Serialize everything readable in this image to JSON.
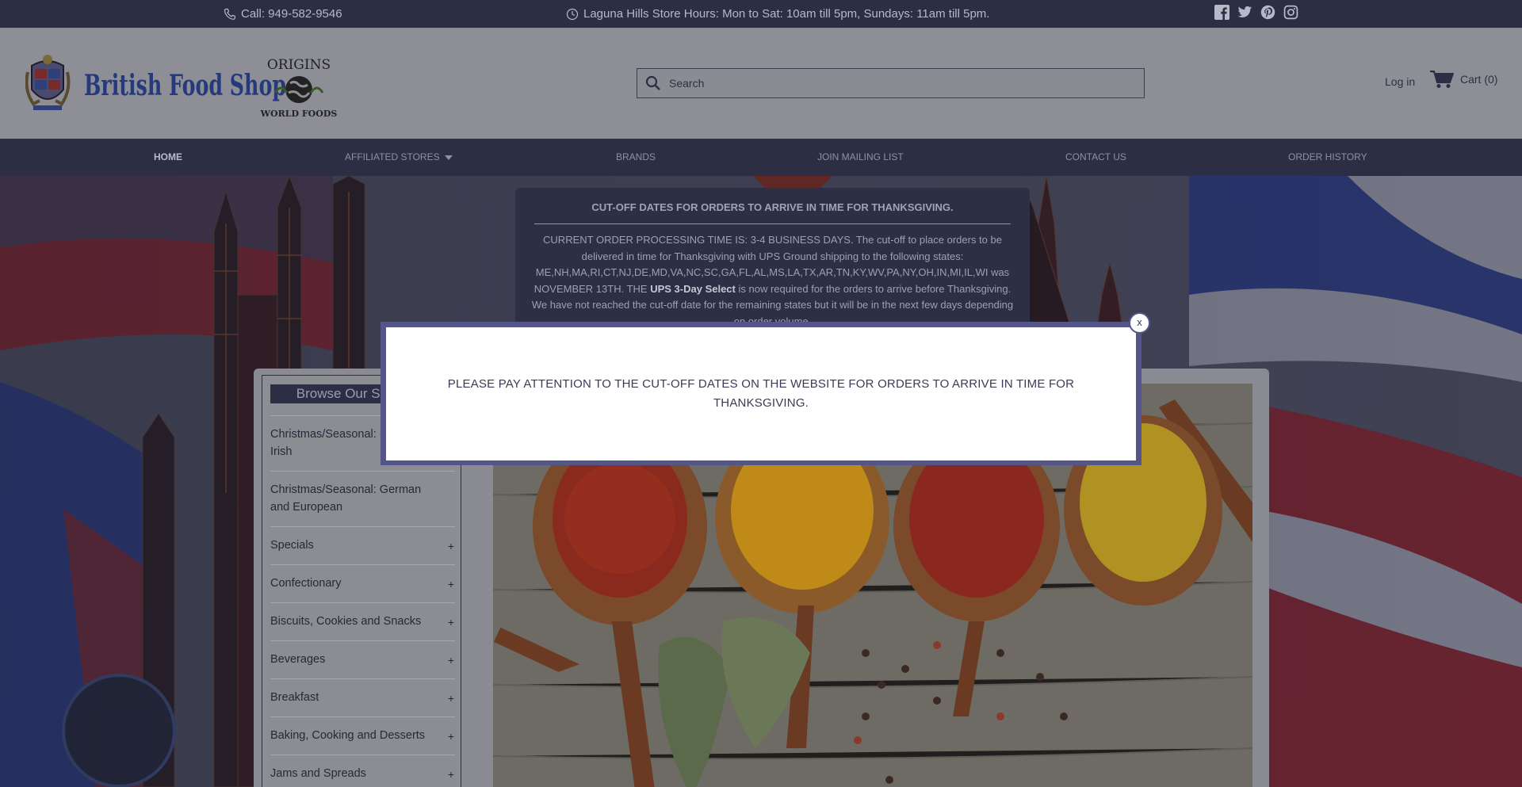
{
  "topbar": {
    "phone": "Call: 949-582-9546",
    "hours": "Laguna Hills Store Hours: Mon to Sat: 10am till 5pm, Sundays: 11am till 5pm.",
    "social_icons": [
      "facebook-icon",
      "twitter-icon",
      "pinterest-icon",
      "instagram-icon"
    ]
  },
  "header": {
    "logo": {
      "text": "British Food Shop",
      "partner_top": "ORIGINS",
      "partner_bottom": "WORLD FOODS"
    },
    "search_placeholder": "Search",
    "login": "Log in",
    "cart": "Cart (0)"
  },
  "nav": [
    {
      "label": "HOME"
    },
    {
      "label": "AFFILIATED STORES"
    },
    {
      "label": "BRANDS"
    },
    {
      "label": "JOIN MAILING LIST"
    },
    {
      "label": "CONTACT US"
    },
    {
      "label": "ORDER HISTORY"
    }
  ],
  "notice": {
    "title": "CUT-OFF DATES FOR ORDERS TO ARRIVE IN TIME FOR THANKSGIVING.",
    "body_1": "CURRENT ORDER PROCESSING TIME IS: 3-4 BUSINESS DAYS. The cut-off to place orders to be delivered in time for Thanksgiving with UPS Ground shipping to the following states: ME,NH,MA,RI,CT,NJ,DE,MD,VA,NC,SC,GA,FL,AL,MS,LA,TX,AR,TN,KY,WV,PA,NY,OH,IN,MI,IL,WI was NOVEMBER 13TH. THE ",
    "body_bold": "UPS 3-Day Select",
    "body_2": " is now required for the orders to arrive before Thanksgiving. We have not reached the cut-off date for the remaining states but it will be in the next few days depending on order volume."
  },
  "sidebar": {
    "title": "Browse Our Selection",
    "items": [
      {
        "label": "Christmas/Seasonal: British and Irish",
        "plus": ""
      },
      {
        "label": "Christmas/Seasonal: German and European",
        "plus": ""
      },
      {
        "label": "Specials",
        "plus": "+"
      },
      {
        "label": "Confectionary",
        "plus": "+"
      },
      {
        "label": "Biscuits, Cookies and Snacks",
        "plus": "+"
      },
      {
        "label": "Beverages",
        "plus": "+"
      },
      {
        "label": "Breakfast",
        "plus": "+"
      },
      {
        "label": "Baking, Cooking and Desserts",
        "plus": "+"
      },
      {
        "label": "Jams and Spreads",
        "plus": "+"
      }
    ]
  },
  "modal": {
    "message": "PLEASE PAY ATTENTION TO THE CUT-OFF DATES ON THE WEBSITE FOR ORDERS TO ARRIVE IN TIME FOR THANKSGIVING.",
    "close": "x"
  }
}
